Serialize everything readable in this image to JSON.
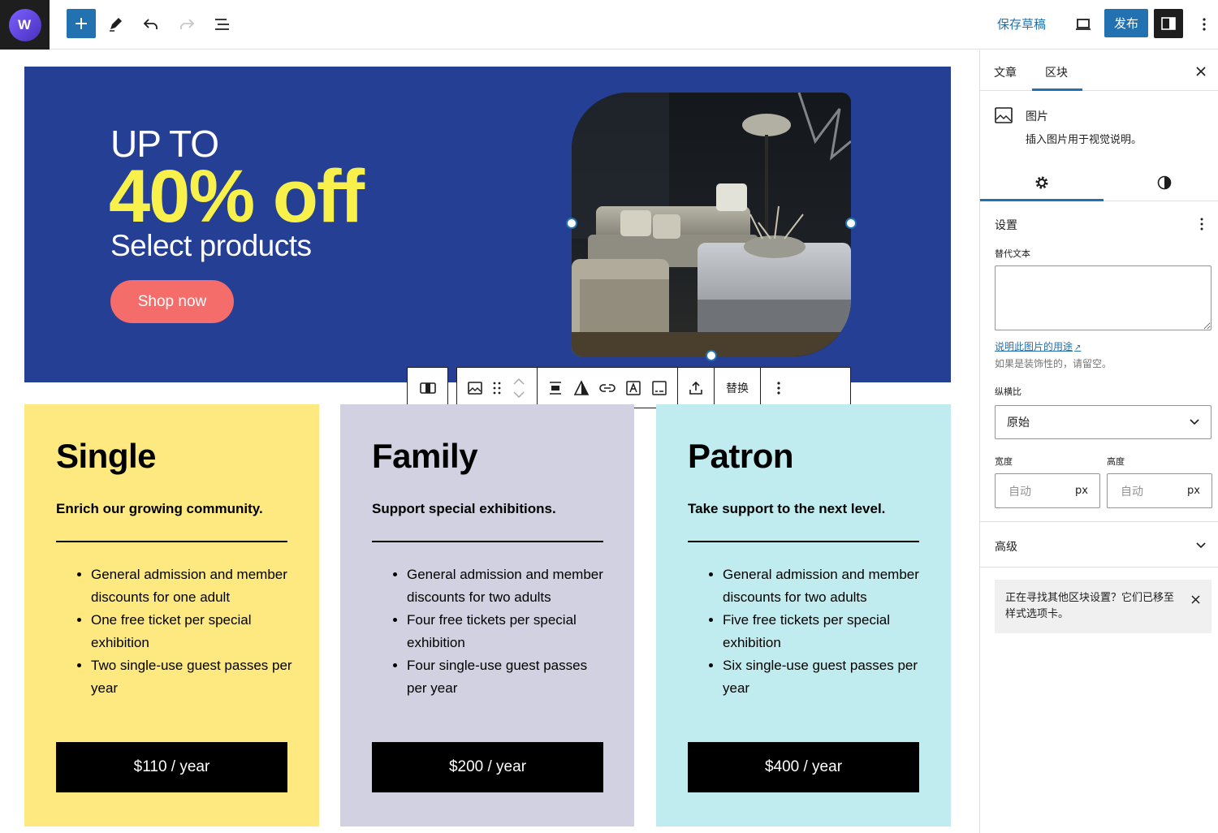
{
  "topbar": {
    "logo_text": "W",
    "save_draft": "保存草稿",
    "publish": "发布"
  },
  "hero": {
    "line1": "UP TO",
    "line2": "40% off",
    "line3": "Select products",
    "cta": "Shop now",
    "colors": {
      "background": "#243f94",
      "highlight": "#f8f14c",
      "button": "#f46d6b"
    }
  },
  "block_toolbar": {
    "replace": "替换",
    "icons": [
      "columns-icon",
      "image-icon",
      "drag-handle-icon",
      "move-up-icon",
      "move-down-icon",
      "align-icon",
      "duotone-icon",
      "link-icon",
      "alt-text-icon",
      "caption-icon",
      "upload-icon",
      "more-options-icon"
    ]
  },
  "pricing": [
    {
      "title": "Single",
      "tagline": "Enrich our growing community.",
      "features": [
        "General admission and member discounts for one adult",
        "One free ticket per special exhibition",
        "Two single-use guest passes per year"
      ],
      "price": "$110 / year",
      "color": "#fde97f"
    },
    {
      "title": "Family",
      "tagline": "Support special exhibitions.",
      "features": [
        "General admission and member discounts for two adults",
        "Four free tickets per special exhibition",
        "Four single-use guest passes per year"
      ],
      "price": "$200 / year",
      "color": "#d2d1e1"
    },
    {
      "title": "Patron",
      "tagline": "Take support to the next level.",
      "features": [
        "General admission and member discounts for two adults",
        "Five free tickets per special exhibition",
        "Six single-use guest passes per year"
      ],
      "price": "$400 / year",
      "color": "#c0ecf0"
    }
  ],
  "sidebar": {
    "tabs": [
      "文章",
      "区块"
    ],
    "active_tab": "区块",
    "block": {
      "name": "图片",
      "description": "插入图片用于视觉说明。"
    },
    "settings": {
      "title": "设置",
      "alt_label": "替代文本",
      "alt_value": "",
      "help_link": "说明此图片的用途",
      "help_text": "如果是装饰性的，请留空。",
      "aspect_label": "纵横比",
      "aspect_value": "原始",
      "width_label": "宽度",
      "height_label": "高度",
      "width_placeholder": "自动",
      "height_placeholder": "自动",
      "unit": "px"
    },
    "advanced": "高级",
    "notice": "正在寻找其他区块设置？它们已移至样式选项卡。"
  }
}
